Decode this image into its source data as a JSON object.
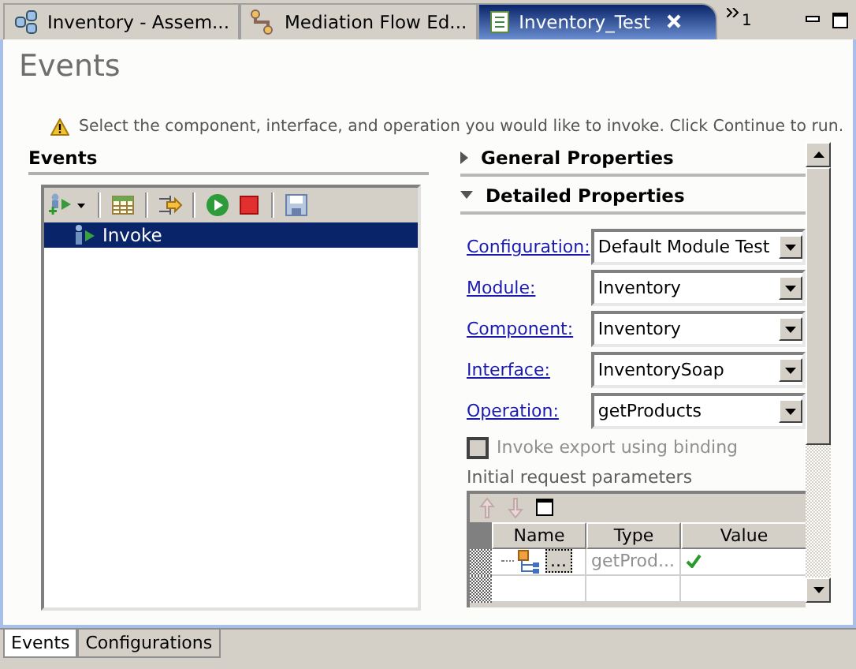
{
  "editor_tabs": [
    {
      "label": "Inventory - Assem...",
      "kind": "assembly",
      "selected": false,
      "closable": false
    },
    {
      "label": "Mediation Flow Ed...",
      "kind": "mediation",
      "selected": false,
      "closable": false
    },
    {
      "label": "Inventory_Test",
      "kind": "test",
      "selected": true,
      "closable": true
    }
  ],
  "overflow_count": "1",
  "page_title": "Events",
  "message": "Select the component, interface, and operation you would like to invoke. Click Continue to run.",
  "events_panel": {
    "title": "Events",
    "tree": [
      {
        "label": "Invoke",
        "selected": true
      }
    ]
  },
  "sections": [
    {
      "title": "General Properties",
      "expanded": false
    },
    {
      "title": "Detailed Properties",
      "expanded": true
    }
  ],
  "fields": [
    {
      "label": "Configuration:",
      "value": "Default Module Test"
    },
    {
      "label": "Module:",
      "value": "Inventory"
    },
    {
      "label": "Component:",
      "value": "Inventory"
    },
    {
      "label": "Interface:",
      "value": "InventorySoap"
    },
    {
      "label": "Operation:",
      "value": "getProducts"
    }
  ],
  "binding_checkbox": {
    "label": "Invoke export using binding",
    "checked": false,
    "disabled": true
  },
  "params_label": "Initial request parameters",
  "params_table": {
    "columns": [
      "Name",
      "Type",
      "Value"
    ],
    "rows": [
      {
        "name": "...",
        "type": "getProd...",
        "valid": true
      }
    ]
  },
  "bottom_tabs": [
    {
      "label": "Events",
      "selected": true
    },
    {
      "label": "Configurations",
      "selected": false
    }
  ]
}
